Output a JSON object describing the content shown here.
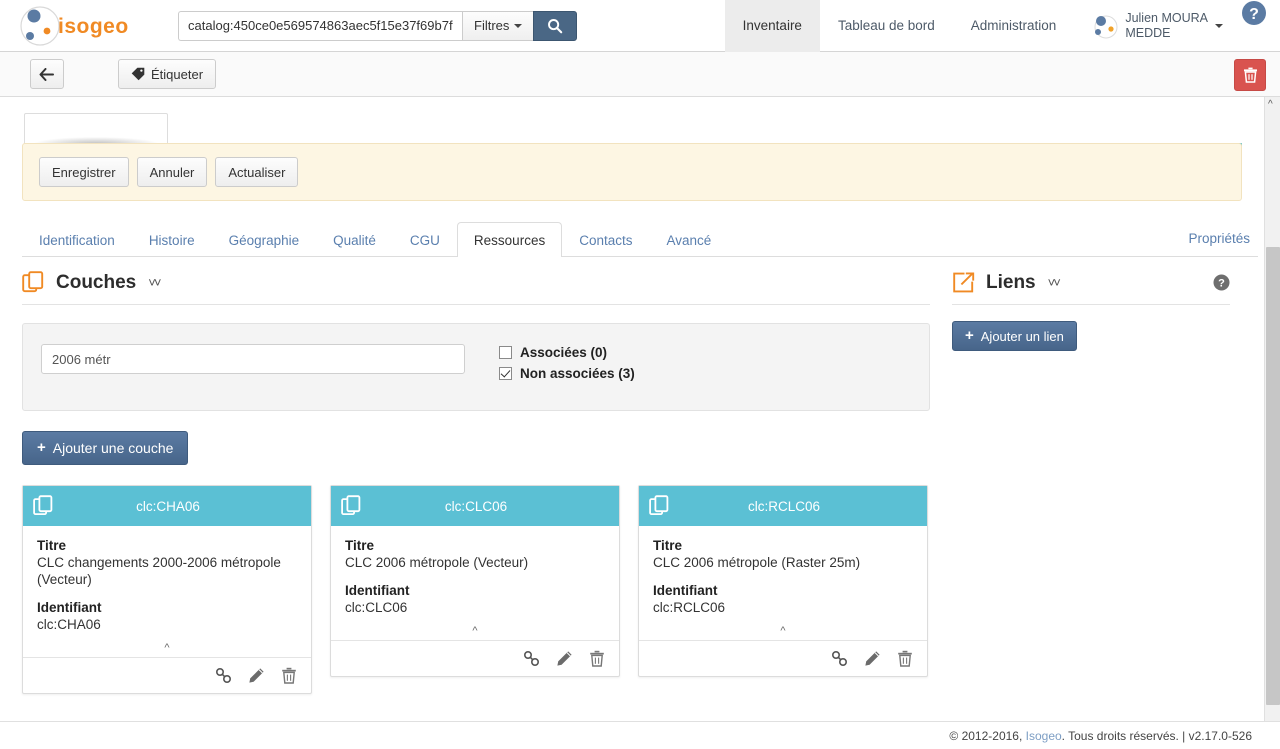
{
  "brand": {
    "name": "isogeo",
    "accent_color": "#f08a24"
  },
  "search": {
    "value": "catalog:450ce0e569574863aec5f15e37f69b7f",
    "placeholder": "",
    "filters_label": "Filtres",
    "search_icon": "search-icon"
  },
  "nav": {
    "items": [
      {
        "label": "Inventaire",
        "active": true
      },
      {
        "label": "Tableau de bord",
        "active": false
      },
      {
        "label": "Administration",
        "active": false
      }
    ],
    "user": {
      "line1": "Julien MOURA",
      "line2": "MEDDE"
    },
    "help_icon": "help-icon"
  },
  "actionbar": {
    "back_label": "",
    "tag_label": "Étiqueter",
    "delete_icon": "trash-icon"
  },
  "savebar": {
    "save_label": "Enregistrer",
    "cancel_label": "Annuler",
    "refresh_label": "Actualiser"
  },
  "tabs": {
    "items": [
      {
        "label": "Identification",
        "active": false
      },
      {
        "label": "Histoire",
        "active": false
      },
      {
        "label": "Géographie",
        "active": false
      },
      {
        "label": "Qualité",
        "active": false
      },
      {
        "label": "CGU",
        "active": false
      },
      {
        "label": "Ressources",
        "active": true
      },
      {
        "label": "Contacts",
        "active": false
      },
      {
        "label": "Avancé",
        "active": false
      }
    ],
    "right_link": "Propriétés"
  },
  "layers_section": {
    "title": "Couches",
    "icon": "layers-icon",
    "collapse_icon": "chevron-double-down-icon",
    "filter": {
      "value": "2006 métr",
      "placeholder": "",
      "checkboxes": [
        {
          "label": "Associées (0)",
          "checked": false
        },
        {
          "label": "Non associées (3)",
          "checked": true
        }
      ]
    },
    "add_button": "Ajouter une couche",
    "field_labels": {
      "title": "Titre",
      "identifier": "Identifiant"
    },
    "cards": [
      {
        "header": "clc:CHA06",
        "title": "CLC changements 2000-2006 métropole (Vecteur)",
        "identifier": "clc:CHA06"
      },
      {
        "header": "clc:CLC06",
        "title": "CLC 2006 métropole (Vecteur)",
        "identifier": "clc:CLC06"
      },
      {
        "header": "clc:RCLC06",
        "title": "CLC 2006 métropole (Raster 25m)",
        "identifier": "clc:RCLC06"
      }
    ],
    "card_actions": [
      "link-icon",
      "edit-pencil-icon",
      "trash-icon"
    ],
    "header_color": "#5bc0d4"
  },
  "links_section": {
    "title": "Liens",
    "icon": "external-link-icon",
    "collapse_icon": "chevron-double-down-icon",
    "help_icon": "help-icon",
    "add_button": "Ajouter un lien"
  },
  "footer": {
    "copyright": "© 2012-2016, ",
    "brand_link": "Isogeo",
    "rights": ". Tous droits réservés. | v2.17.0-526"
  }
}
